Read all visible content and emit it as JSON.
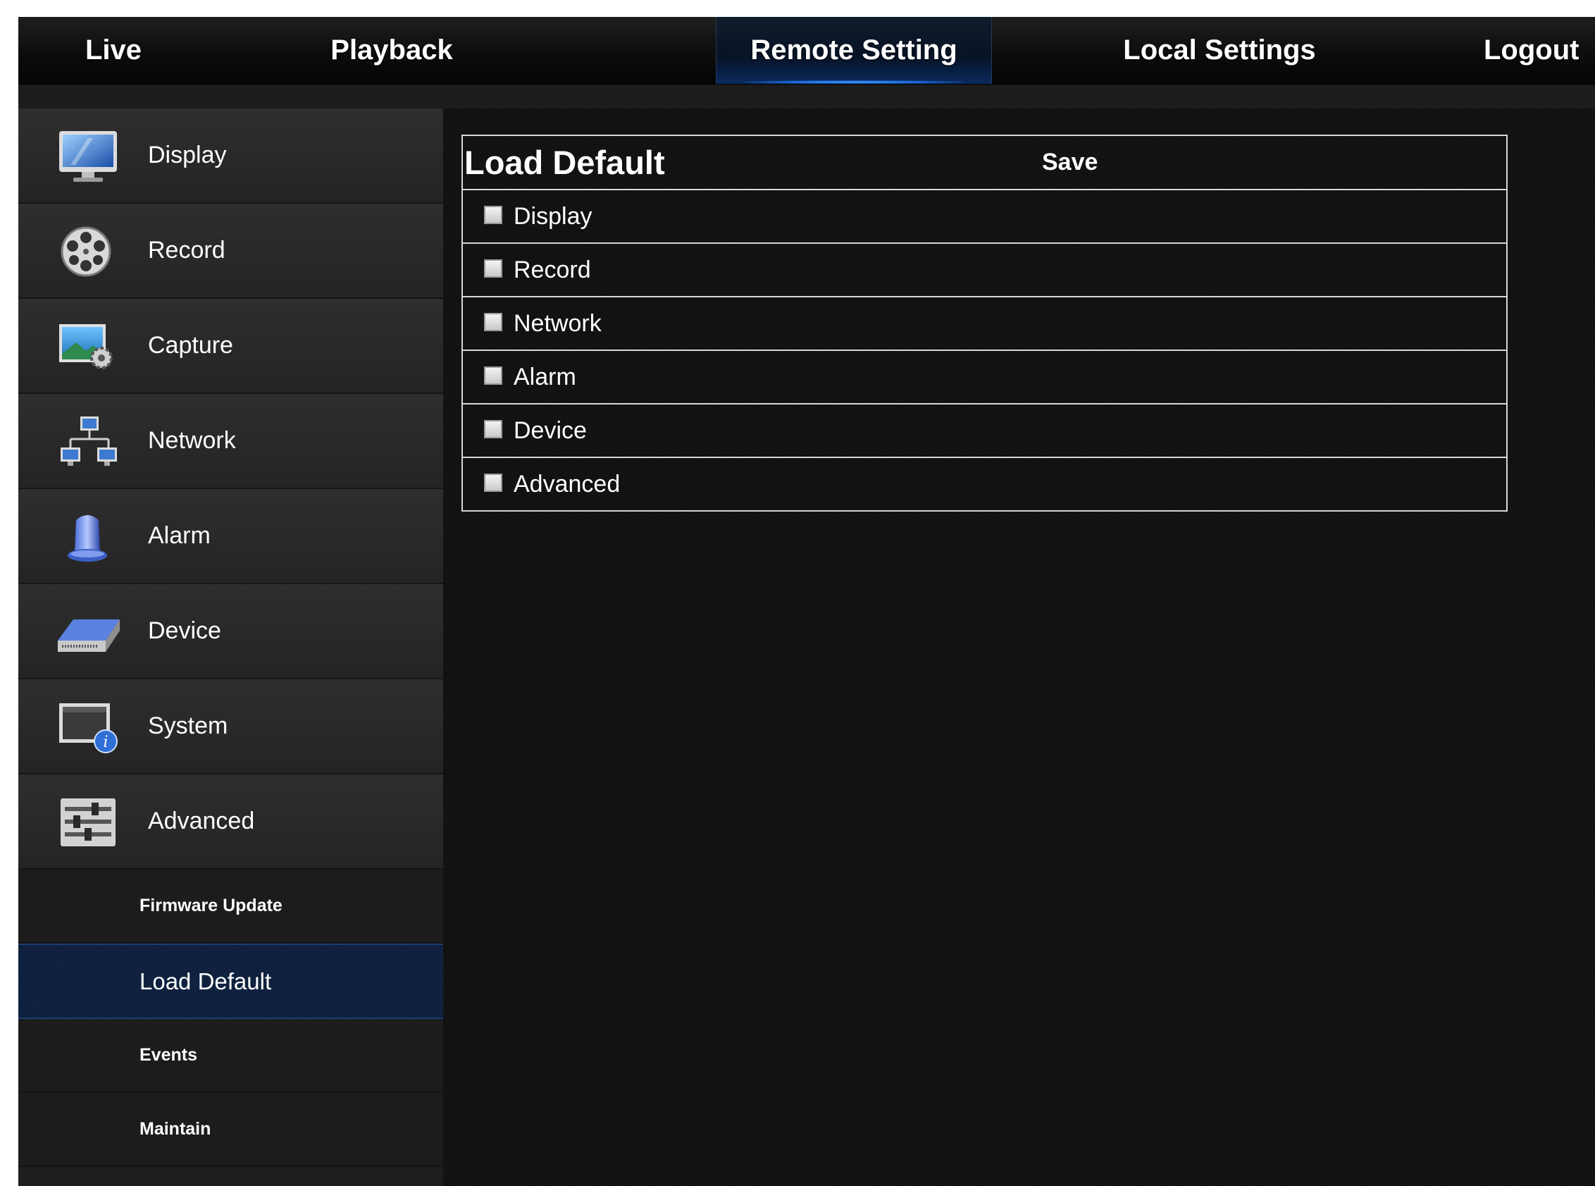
{
  "topnav": {
    "tabs": [
      {
        "label": "Live",
        "active": false
      },
      {
        "label": "Playback",
        "active": false
      },
      {
        "label": "Remote Setting",
        "active": true
      },
      {
        "label": "Local Settings",
        "active": false
      },
      {
        "label": "Logout",
        "active": false
      }
    ]
  },
  "sidebar": {
    "items": [
      {
        "label": "Display",
        "icon": "monitor-icon"
      },
      {
        "label": "Record",
        "icon": "film-reel-icon"
      },
      {
        "label": "Capture",
        "icon": "capture-gear-icon"
      },
      {
        "label": "Network",
        "icon": "network-icon"
      },
      {
        "label": "Alarm",
        "icon": "alarm-siren-icon"
      },
      {
        "label": "Device",
        "icon": "hard-drive-icon"
      },
      {
        "label": "System",
        "icon": "system-info-icon"
      },
      {
        "label": "Advanced",
        "icon": "sliders-icon"
      }
    ],
    "subitems": [
      {
        "label": "Firmware Update",
        "selected": false
      },
      {
        "label": "Load Default",
        "selected": true
      },
      {
        "label": "Events",
        "selected": false
      },
      {
        "label": "Maintain",
        "selected": false
      }
    ]
  },
  "panel": {
    "title": "Load Default",
    "save_label": "Save",
    "options": [
      {
        "label": "Display",
        "checked": false
      },
      {
        "label": "Record",
        "checked": false
      },
      {
        "label": "Network",
        "checked": false
      },
      {
        "label": "Alarm",
        "checked": false
      },
      {
        "label": "Device",
        "checked": false
      },
      {
        "label": "Advanced",
        "checked": false
      }
    ]
  },
  "colors": {
    "accent": "#1b68d8",
    "selected_bg": "#0d1f3d",
    "background": "#111111"
  }
}
